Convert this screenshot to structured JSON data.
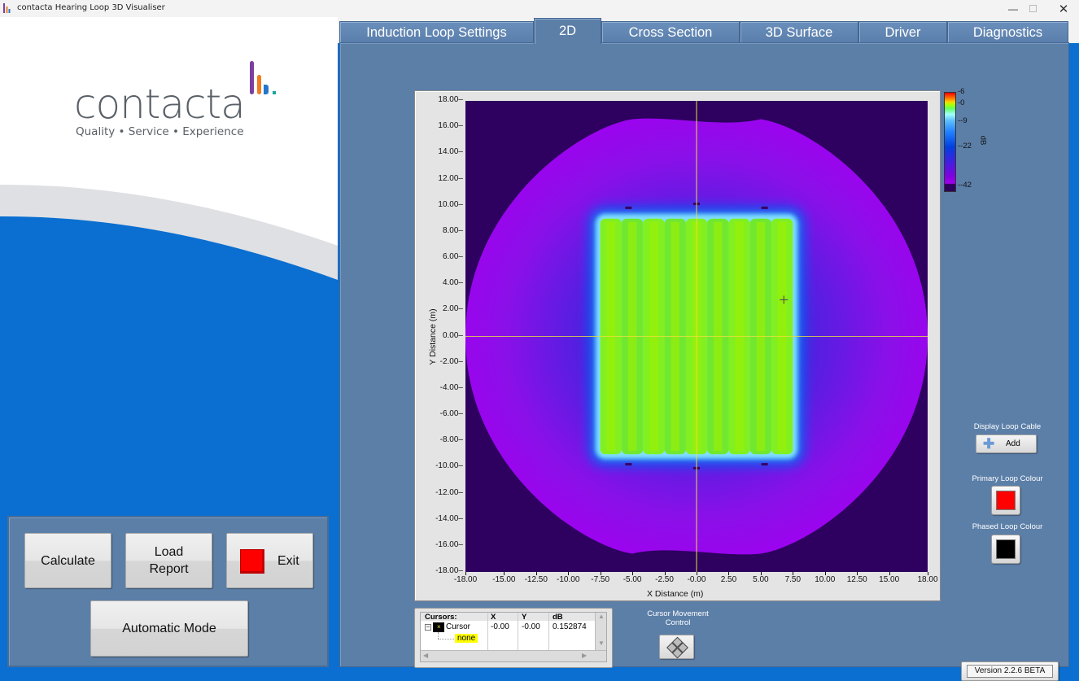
{
  "window": {
    "title": "contacta Hearing Loop 3D Visualiser",
    "minimize_icon": "minimize-icon",
    "maximize_icon": "maximize-icon",
    "close_icon": "close-icon"
  },
  "branding": {
    "logo_text": "contacta",
    "tagline": "Quality • Service • Experience",
    "colors": {
      "purple": "#7b3fa0",
      "orange": "#f07d22",
      "blue": "#2478c9",
      "teal": "#1aa59a",
      "text": "#5a6068"
    }
  },
  "actions": {
    "calculate": "Calculate",
    "load_report_line1": "Load",
    "load_report_line2": "Report",
    "exit": "Exit",
    "exit_indicator_color": "#ff0000",
    "automatic_mode": "Automatic Mode"
  },
  "tabs": [
    {
      "label": "Induction Loop Settings",
      "active": false
    },
    {
      "label": "2D",
      "active": true
    },
    {
      "label": "Cross Section",
      "active": false
    },
    {
      "label": "3D Surface",
      "active": false
    },
    {
      "label": "Driver",
      "active": false
    },
    {
      "label": "Diagnostics",
      "active": false
    }
  ],
  "chart_data": {
    "type": "heatmap",
    "title": "",
    "xlabel": "X Distance (m)",
    "ylabel": "Y Distance (m)",
    "xlim": [
      -18,
      18
    ],
    "ylim": [
      -18,
      18
    ],
    "x_ticks": [
      "-18.00",
      "-15.00",
      "-12.50",
      "-10.00",
      "-7.50",
      "-5.00",
      "-2.50",
      "-0.00",
      "2.50",
      "5.00",
      "7.50",
      "10.00",
      "12.50",
      "15.00",
      "18.00"
    ],
    "x_tick_values": [
      -18,
      -15,
      -12.5,
      -10,
      -7.5,
      -5,
      -2.5,
      0,
      2.5,
      5,
      7.5,
      10,
      12.5,
      15,
      18
    ],
    "y_ticks": [
      "18.00",
      "16.00",
      "14.00",
      "12.00",
      "10.00",
      "8.00",
      "6.00",
      "4.00",
      "2.00",
      "0.00",
      "-2.00",
      "-4.00",
      "-6.00",
      "-8.00",
      "-10.00",
      "-12.00",
      "-14.00",
      "-16.00",
      "-18.00"
    ],
    "y_tick_values": [
      18,
      16,
      14,
      12,
      10,
      8,
      6,
      4,
      2,
      0,
      -2,
      -4,
      -6,
      -8,
      -10,
      -12,
      -14,
      -16,
      -18
    ],
    "loop_region": {
      "x": [
        -7.5,
        7.5
      ],
      "y": [
        -9,
        9
      ],
      "level_db": 0,
      "strips": 9
    },
    "colorbar": {
      "label": "dB",
      "ticks": [
        "6",
        "0",
        "-9",
        "-22",
        "-42"
      ],
      "tick_values": [
        6,
        0,
        -9,
        -22,
        -42
      ],
      "range": [
        -42,
        6
      ]
    },
    "cursor": {
      "x": 0,
      "y": 0,
      "color": "#e8e040"
    },
    "markers": [
      {
        "x": -5.3,
        "y": 9.8
      },
      {
        "x": 0,
        "y": 10.1
      },
      {
        "x": 5.3,
        "y": 9.8
      },
      {
        "x": -5.3,
        "y": -9.8
      },
      {
        "x": 0,
        "y": -10.1
      },
      {
        "x": 5.3,
        "y": -9.8
      }
    ],
    "crosshair_marker": {
      "x": 6.8,
      "y": 2.8
    }
  },
  "cursors_table": {
    "headers": [
      "Cursors:",
      "X",
      "Y",
      "dB"
    ],
    "rows": [
      {
        "name": "Cursor",
        "x": "-0.00",
        "y": "-0.00",
        "db": "0.152874",
        "snap": "none"
      }
    ]
  },
  "cursor_movement": {
    "label_line1": "Cursor Movement",
    "label_line2": "Control"
  },
  "loop_display": {
    "display_loop_cable_label": "Display Loop Cable",
    "add_label": "Add",
    "primary_loop_colour_label": "Primary Loop Colour",
    "primary_loop_colour": "#ff0000",
    "phased_loop_colour_label": "Phased Loop Colour",
    "phased_loop_colour": "#000000"
  },
  "version": "Version 2.2.6 BETA"
}
